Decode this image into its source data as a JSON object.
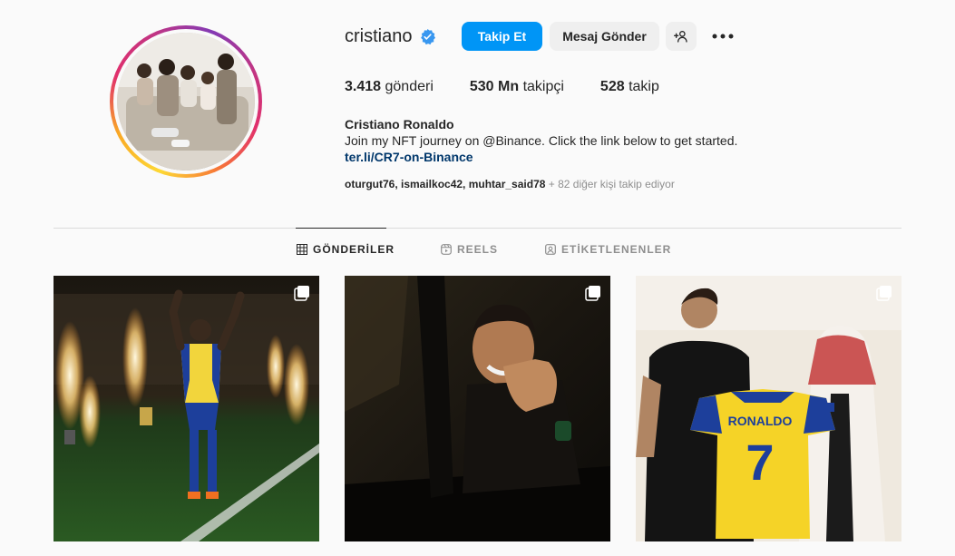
{
  "profile": {
    "username": "cristiano",
    "verified": true,
    "full_name": "Cristiano Ronaldo",
    "bio": "Join my NFT journey on @Binance. Click the link below to get started.",
    "link": "ter.li/CR7-on-Binance",
    "followed_by_names": "oturgut76, ismailkoc42, muhtar_said78",
    "followed_by_more": " + 82 diğer kişi takip ediyor"
  },
  "actions": {
    "follow_label": "Takip Et",
    "message_label": "Mesaj Gönder",
    "add_user_icon": "add-user-icon",
    "more_icon": "more-icon"
  },
  "stats": {
    "posts_count": "3.418",
    "posts_label": " gönderi",
    "followers_count": "530 Mn",
    "followers_label": " takipçi",
    "following_count": "528",
    "following_label": " takip"
  },
  "tabs": [
    {
      "label": "GÖNDERİLER",
      "icon": "grid-icon",
      "active": true
    },
    {
      "label": "REELS",
      "icon": "reels-icon",
      "active": false
    },
    {
      "label": "ETİKETLENENLER",
      "icon": "tag-icon",
      "active": false
    }
  ],
  "posts": [
    {
      "type": "carousel",
      "jersey_number": ""
    },
    {
      "type": "carousel",
      "jersey_number": ""
    },
    {
      "type": "carousel",
      "jersey_name": "RONALDO",
      "jersey_number": "7"
    }
  ],
  "colors": {
    "accent": "#0095f6",
    "verified": "#3897f0",
    "link": "#00376b",
    "muted": "#8e8e8e",
    "jersey_yellow": "#f5d327",
    "jersey_blue": "#1d3f9b"
  }
}
